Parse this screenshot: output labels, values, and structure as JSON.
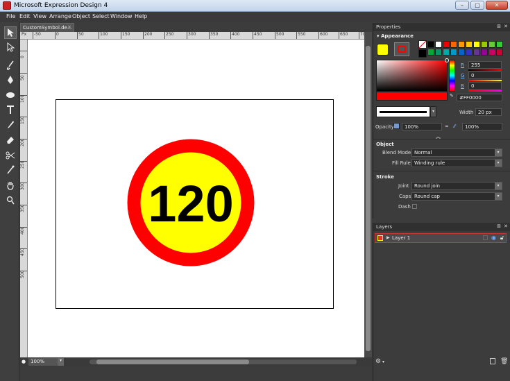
{
  "window": {
    "title": "Microsoft Expression Design 4",
    "minimize": "–",
    "maximize": "□",
    "close": "✕"
  },
  "menu": [
    "File",
    "Edit",
    "View",
    "Arrange",
    "Object",
    "Select",
    "Window",
    "Help"
  ],
  "tools": [
    "selection-arrow-icon",
    "direct-select-icon",
    "paintbrush-icon",
    "pen-icon",
    "ellipse-icon",
    "text-tool-icon",
    "eyedropper-icon",
    "eraser-icon",
    "scissors-icon",
    "gradient-icon",
    "hand-icon",
    "zoom-icon"
  ],
  "document": {
    "tab_label": "CustomSymbol.de...",
    "tab_close": "×",
    "artwork_text": "120",
    "colors": {
      "ring": "#FF0000",
      "fill": "#FFFF00",
      "text": "#000000"
    }
  },
  "ruler": {
    "corner": "Px",
    "h_ticks": [
      "-50",
      "0",
      "50",
      "100",
      "150",
      "200",
      "250",
      "300",
      "350",
      "400",
      "450",
      "500",
      "550",
      "600",
      "650",
      "70"
    ],
    "v_ticks": [
      "0",
      "50",
      "100",
      "150",
      "200",
      "250",
      "300",
      "350",
      "400",
      "450",
      "500"
    ]
  },
  "status": {
    "zoom": "100%"
  },
  "properties": {
    "tab": "Properties",
    "appearance": "Appearance",
    "rgb": {
      "r_label": "R",
      "r": "255",
      "g_label": "G",
      "g": "0",
      "b_label": "B",
      "b": "0"
    },
    "hex": "#FF0000",
    "width_label": "Width",
    "width_value": "20 px",
    "opacity_label": "Opacity",
    "opacity_value": "100%",
    "opacity2_value": "100%",
    "object_header": "Object",
    "blend_mode_label": "Blend Mode",
    "blend_mode_value": "Normal",
    "fill_rule_label": "Fill Rule",
    "fill_rule_value": "Winding rule",
    "stroke_header": "Stroke",
    "joint_label": "Joint",
    "joint_value": "Round join",
    "caps_label": "Caps",
    "caps_value": "Round cap",
    "dash_label": "Dash"
  },
  "layers": {
    "tab": "Layers",
    "items": [
      {
        "name": "Layer 1"
      }
    ]
  }
}
